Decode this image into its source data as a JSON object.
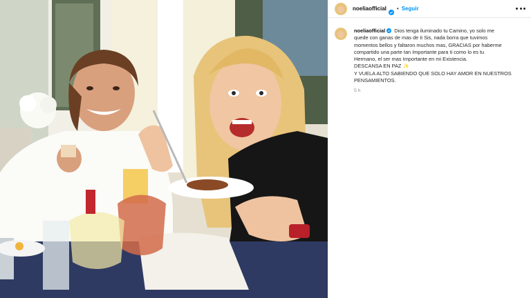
{
  "post": {
    "username": "noeliaofficial",
    "follow_label": "Seguir",
    "separator": "•",
    "caption_lines": [
      "Dios tenga iluminado tu Camino, yo solo me",
      "quede con ganas de mas de ti Sis, nada borra que tuvimos",
      "momentos bellos y faltaron muchos mas, GRACIAS por haberme",
      "compartido una parte tan Importante para ti como lo es tu",
      "Hermano, el ser mas Importante en mi Existencia.",
      "DESCANSA EN PAZ ✨",
      "Y VUELA ALTO SABIENDO QUE SOLO HAY AMOR EN NUESTROS",
      "PENSAMIENTOS."
    ],
    "time_ago": "5 h"
  },
  "icons": {
    "verified": "verified-badge-icon",
    "more": "more-options-icon"
  },
  "colors": {
    "accent_blue": "#0095f6",
    "text": "#262626",
    "muted": "#8e8e8e"
  }
}
